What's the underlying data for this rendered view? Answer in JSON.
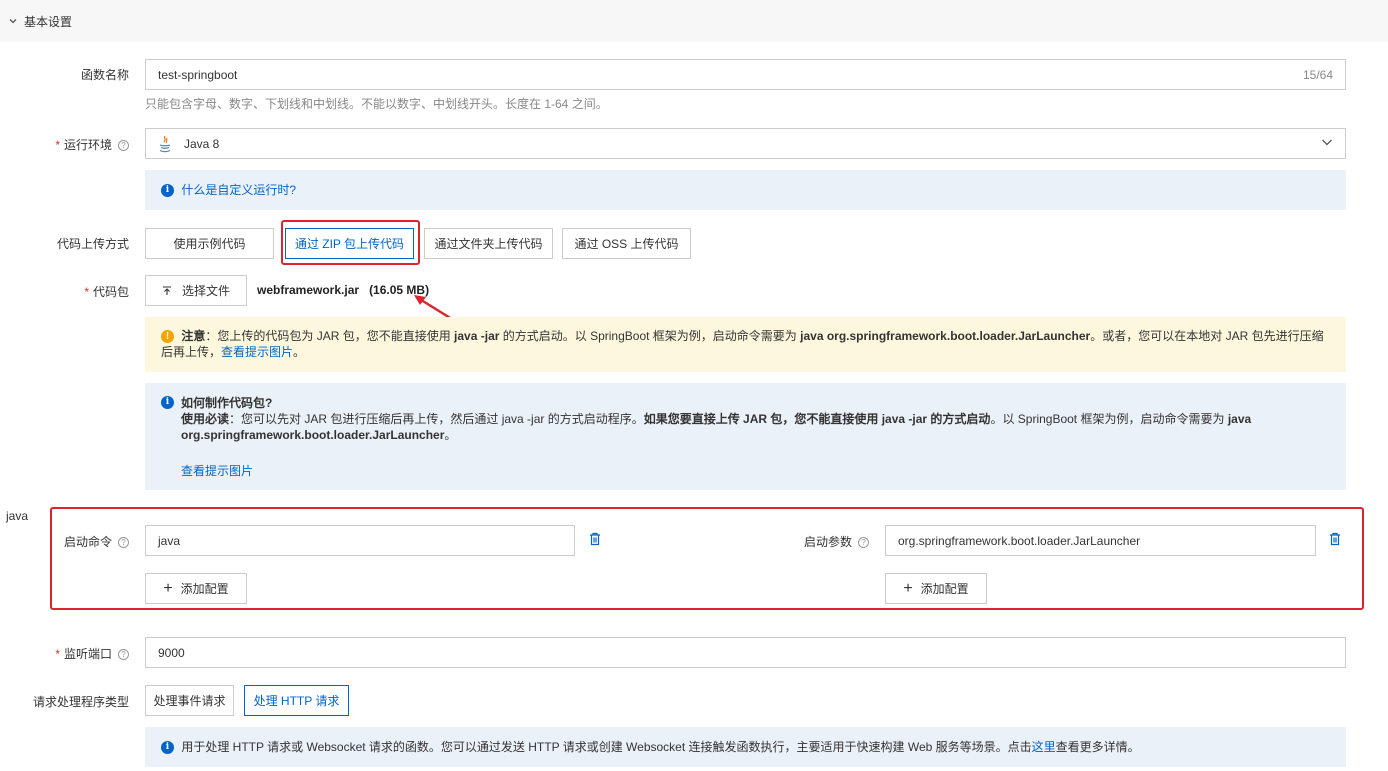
{
  "section": {
    "title": "基本设置"
  },
  "function_name": {
    "label": "函数名称",
    "value": "test-springboot",
    "count": "15/64",
    "hint": "只能包含字母、数字、下划线和中划线。不能以数字、中划线开头。长度在 1-64 之间。"
  },
  "runtime": {
    "required_mark": "*",
    "label": "运行环境",
    "value": "Java 8",
    "help_link": "什么是自定义运行时?"
  },
  "upload_method": {
    "label": "代码上传方式",
    "options": [
      "使用示例代码",
      "通过 ZIP 包上传代码",
      "通过文件夹上传代码",
      "通过 OSS 上传代码"
    ],
    "selected_index": 1
  },
  "code_package": {
    "required_mark": "*",
    "label": "代码包",
    "choose_button": "选择文件",
    "file_name": "webframework.jar",
    "file_size": "(16.05 MB)"
  },
  "warning": {
    "prefix": "注意",
    "text1": "：您上传的代码包为 JAR 包，您不能直接使用 ",
    "bold1": "java -jar",
    "text2": " 的方式启动。以 SpringBoot 框架为例，启动命令需要为 ",
    "bold2": "java org.springframework.boot.loader.JarLauncher",
    "text3": "。或者，您可以在本地对 JAR 包先进行压缩后再上传，",
    "link": "查看提示图片",
    "text4": "。"
  },
  "howto": {
    "title": "如何制作代码包?",
    "prefix": "使用必读",
    "text1": "：您可以先对 JAR 包进行压缩后再上传，然后通过 java -jar 的方式启动程序。",
    "bold1": "如果您要直接上传 JAR 包，您不能直接使用 java -jar 的方式启动",
    "text2": "。以 SpringBoot 框架为例，启动命令需要为 ",
    "bold2": "java org.springframework.boot.loader.JarLauncher",
    "text3": "。",
    "link": "查看提示图片"
  },
  "side_label": "java",
  "startup_command": {
    "label": "启动命令",
    "value": "java",
    "add_button": "添加配置"
  },
  "startup_params": {
    "label": "启动参数",
    "value": "org.springframework.boot.loader.JarLauncher",
    "add_button": "添加配置"
  },
  "listen_port": {
    "required_mark": "*",
    "label": "监听端口",
    "value": "9000"
  },
  "handler_type": {
    "label": "请求处理程序类型",
    "options": [
      "处理事件请求",
      "处理 HTTP 请求"
    ],
    "selected_index": 1
  },
  "http_info": {
    "text": "用于处理 HTTP 请求或 Websocket 请求的函数。您可以通过发送 HTTP 请求或创建 Websocket 连接触发函数执行，主要适用于快速构建 Web 服务等场景。点击",
    "link": "这里",
    "text2": "查看更多详情。"
  },
  "colors": {
    "accent": "#0064c8",
    "annotation": "#d9252f",
    "required": "#d93026"
  }
}
